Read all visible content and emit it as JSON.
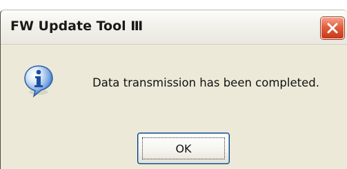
{
  "window": {
    "title": "FW Update Tool Ⅲ",
    "close_icon": "close-icon"
  },
  "message": {
    "icon": "info-icon",
    "text": "Data transmission has been completed."
  },
  "buttons": {
    "ok_label": "OK"
  },
  "colors": {
    "dialog_bg": "#ece9d8",
    "close_button": "#d9512e",
    "info_icon": "#2d6fc4"
  }
}
